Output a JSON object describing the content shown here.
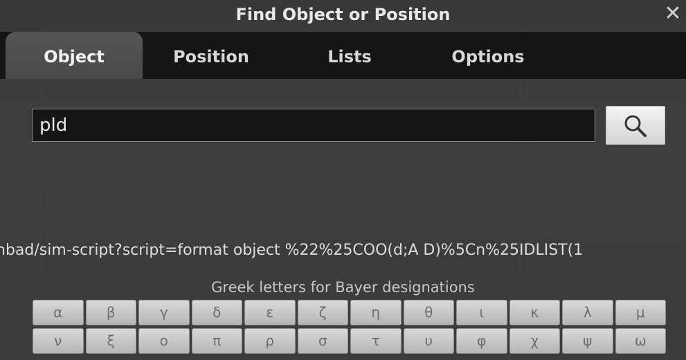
{
  "dialog": {
    "title": "Find Object or Position",
    "close_glyph": "✕"
  },
  "tabs": [
    {
      "label": "Object",
      "active": true
    },
    {
      "label": "Position",
      "active": false
    },
    {
      "label": "Lists",
      "active": false
    },
    {
      "label": "Options",
      "active": false
    }
  ],
  "search": {
    "value": "pld",
    "button_icon": "search-icon"
  },
  "url_text": "nbad/sim-script?script=format object %22%25COO(d;A D)%5Cn%25IDLIST(1",
  "greek": {
    "label": "Greek letters for Bayer designations",
    "row1": [
      "α",
      "β",
      "γ",
      "δ",
      "ε",
      "ζ",
      "η",
      "θ",
      "ι",
      "κ",
      "λ",
      "μ"
    ],
    "row2": [
      "ν",
      "ξ",
      "ο",
      "π",
      "ρ",
      "σ",
      "τ",
      "υ",
      "φ",
      "χ",
      "ψ",
      "ω"
    ]
  },
  "colors": {
    "tab_bar": "#121212",
    "active_tab": "#4f4f4f",
    "input_bg": "#161616",
    "greek_button": "#c8c8c8"
  }
}
